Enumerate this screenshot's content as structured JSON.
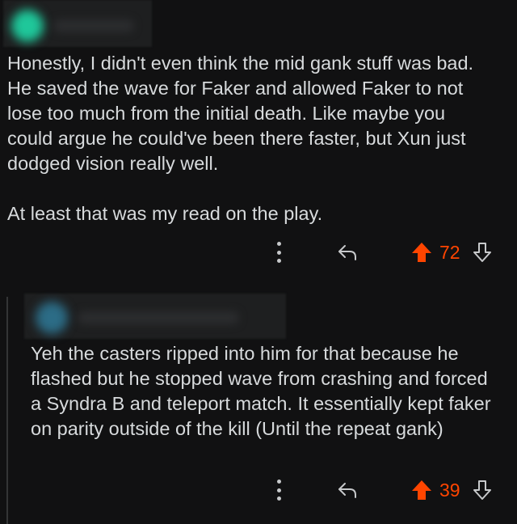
{
  "comments": [
    {
      "body_paragraphs": [
        "Honestly, I didn't even think the mid gank stuff was bad. He saved the wave for Faker and allowed Faker to not lose too much from the initial death. Like maybe you could argue he could've been there faster, but Xun just dodged vision really well.",
        "At least that was my read on the play."
      ],
      "score": "72",
      "vote_state": "upvoted",
      "avatar_color": "#1fc79a"
    },
    {
      "body_paragraphs": [
        "Yeh the casters ripped into him for that because he flashed but he stopped wave from crashing and forced a Syndra B and teleport match. It essentially kept faker on parity outside of the kill (Until the repeat gank)"
      ],
      "score": "39",
      "vote_state": "upvoted",
      "avatar_color": "#2c6c86"
    }
  ],
  "icons": {
    "more": "more-vertical-icon",
    "reply": "reply-arrow-icon",
    "upvote": "upvote-arrow-icon",
    "downvote": "downvote-arrow-icon"
  },
  "colors": {
    "background": "#111112",
    "text": "#d7dadc",
    "upvote_accent": "#ff4500",
    "icon": "#c7c9cb",
    "thread_line": "#343536"
  }
}
